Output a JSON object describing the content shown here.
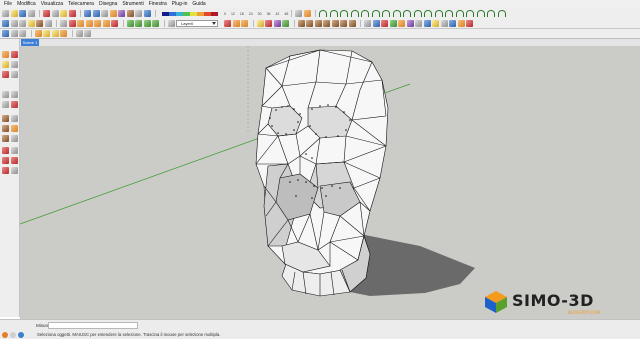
{
  "menubar": {
    "items": [
      "File",
      "Modifica",
      "Visualizza",
      "Telecamera",
      "Disegna",
      "Strumenti",
      "Finestra",
      "Plug-in",
      "Guida"
    ]
  },
  "toolbar": {
    "ruler_labels": [
      "0",
      "12",
      "18",
      "24",
      "30",
      "36",
      "42",
      "48"
    ],
    "layer_select": {
      "value": "Layer0"
    }
  },
  "scene": {
    "tab_label": "Scene 1"
  },
  "watermark": {
    "brand": "SIMO-3D",
    "subtitle": "BLOGSPOT.COM"
  },
  "statusbar": {
    "measure_label": "Misure",
    "hint": "Seleziona oggetti. MAIUSC per estendere la selezione. Trascina il mouse per selezione multipla."
  },
  "colors": {
    "viewport_bg": "#cbcbc7",
    "axis_green": "#3a9a2f",
    "model_edges": "#111111",
    "shadow": "#6a6a6a",
    "brand_text": "#222222",
    "brand_orange": "#f39a1f",
    "brand_blue": "#1a62c9"
  }
}
